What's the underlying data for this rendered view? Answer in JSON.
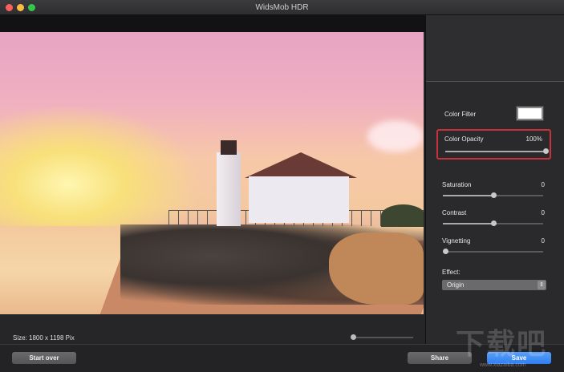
{
  "window": {
    "title": "WidsMob HDR",
    "traffic_colors": [
      "#fc605b",
      "#fdbc40",
      "#34c84a"
    ]
  },
  "image": {
    "size_label": "Size: 1800 x 1198 Pix",
    "zoom_percent": 0
  },
  "panel": {
    "color_filter": {
      "label": "Color Filter",
      "color": "#ffffff"
    },
    "color_opacity": {
      "label": "Color Opacity",
      "value": "100%",
      "percent": 100
    },
    "saturation": {
      "label": "Saturation",
      "value": "0",
      "percent": 50
    },
    "contrast": {
      "label": "Contrast",
      "value": "0",
      "percent": 50
    },
    "vignetting": {
      "label": "Vignetting",
      "value": "0",
      "percent": 0
    },
    "effect": {
      "label": "Effect:",
      "selected": "Origin"
    }
  },
  "buttons": {
    "start_over": "Start over",
    "share": "Share",
    "save": "Save"
  },
  "watermark": {
    "logo": "下载吧",
    "url": "www.xiazaiba.com"
  }
}
